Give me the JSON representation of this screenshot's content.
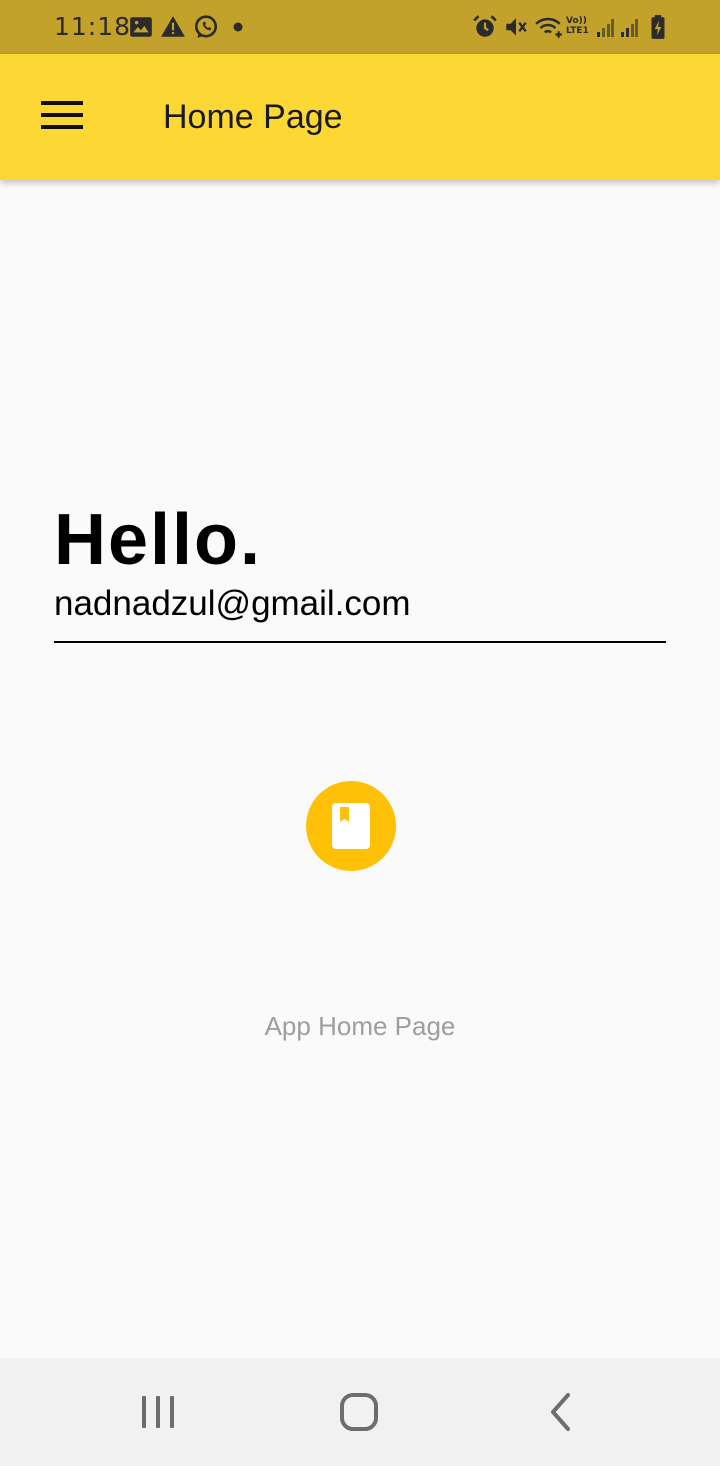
{
  "status_bar": {
    "time": "11:18",
    "left_icons": [
      "gallery-icon",
      "warning-icon",
      "whatsapp-icon",
      "dot-icon"
    ],
    "right_icons": [
      "alarm-icon",
      "mute-icon",
      "wifi-icon",
      "volte-icon",
      "signal-icon",
      "signal-icon",
      "battery-charging-icon"
    ],
    "volte_text": "Vo)) LTE1"
  },
  "app_bar": {
    "title": "Home Page",
    "menu_icon": "menu-icon"
  },
  "main": {
    "greeting": "Hello.",
    "email": "nadnadzul@gmail.com",
    "fab_icon": "book-icon",
    "caption": "App Home Page"
  },
  "nav_bar": {
    "items": [
      "recents-icon",
      "home-icon",
      "back-icon"
    ]
  },
  "colors": {
    "status_bar": "#c2a22a",
    "app_bar": "#fdd835",
    "fab": "#ffc107",
    "background": "#fafafa",
    "caption": "#9e9e9e"
  }
}
